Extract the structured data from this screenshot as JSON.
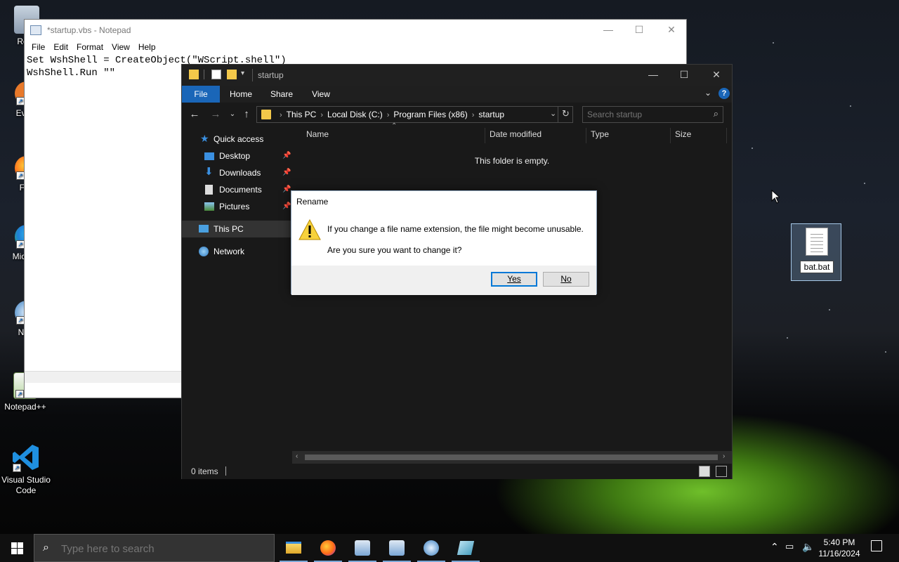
{
  "desktop": {
    "icons": [
      {
        "label": "Recy",
        "icon": "recycle-bin-icon"
      },
      {
        "label": "Every",
        "icon": "everything-app-icon"
      },
      {
        "label": "Fire",
        "icon": "firefox-icon"
      },
      {
        "label": "Micr Ed",
        "icon": "edge-icon"
      },
      {
        "label": "Nets",
        "icon": "netsupport-icon"
      },
      {
        "label": "Notepad++",
        "icon": "notepadpp-icon"
      },
      {
        "label": "Visual Studio Code",
        "icon": "vscode-icon"
      }
    ],
    "file": {
      "label": "bat.bat",
      "icon": "text-file-icon"
    }
  },
  "notepad": {
    "title": "*startup.vbs - Notepad",
    "menu": [
      "File",
      "Edit",
      "Format",
      "View",
      "Help"
    ],
    "lines": [
      "Set WshShell = CreateObject(\"WScript.shell\")",
      "WshShell.Run \"\""
    ]
  },
  "explorer": {
    "title": "startup",
    "ribbon_tabs": [
      "File",
      "Home",
      "Share",
      "View"
    ],
    "breadcrumbs": [
      "This PC",
      "Local Disk (C:)",
      "Program Files (x86)",
      "startup"
    ],
    "search_placeholder": "Search startup",
    "nav": {
      "quick_access": "Quick access",
      "pinned": [
        "Desktop",
        "Downloads",
        "Documents",
        "Pictures"
      ],
      "this_pc": "This PC",
      "network": "Network"
    },
    "columns": [
      "Name",
      "Date modified",
      "Type",
      "Size"
    ],
    "empty_message": "This folder is empty.",
    "status": "0 items"
  },
  "dialog": {
    "title": "Rename",
    "message1": "If you change a file name extension, the file might become unusable.",
    "message2": "Are you sure you want to change it?",
    "yes": "Yes",
    "no": "No"
  },
  "taskbar": {
    "search_placeholder": "Type here to search",
    "apps": [
      "file-explorer-icon",
      "firefox-icon",
      "ie-shortcut-icon",
      "ie-shortcut-icon",
      "netsupport-icon",
      "notepad-icon"
    ],
    "time": "5:40 PM",
    "date": "11/16/2024"
  },
  "colors": {
    "accent": "#0078d7",
    "ribbon_file": "#1a66b8",
    "explorer_bg": "#191919"
  }
}
